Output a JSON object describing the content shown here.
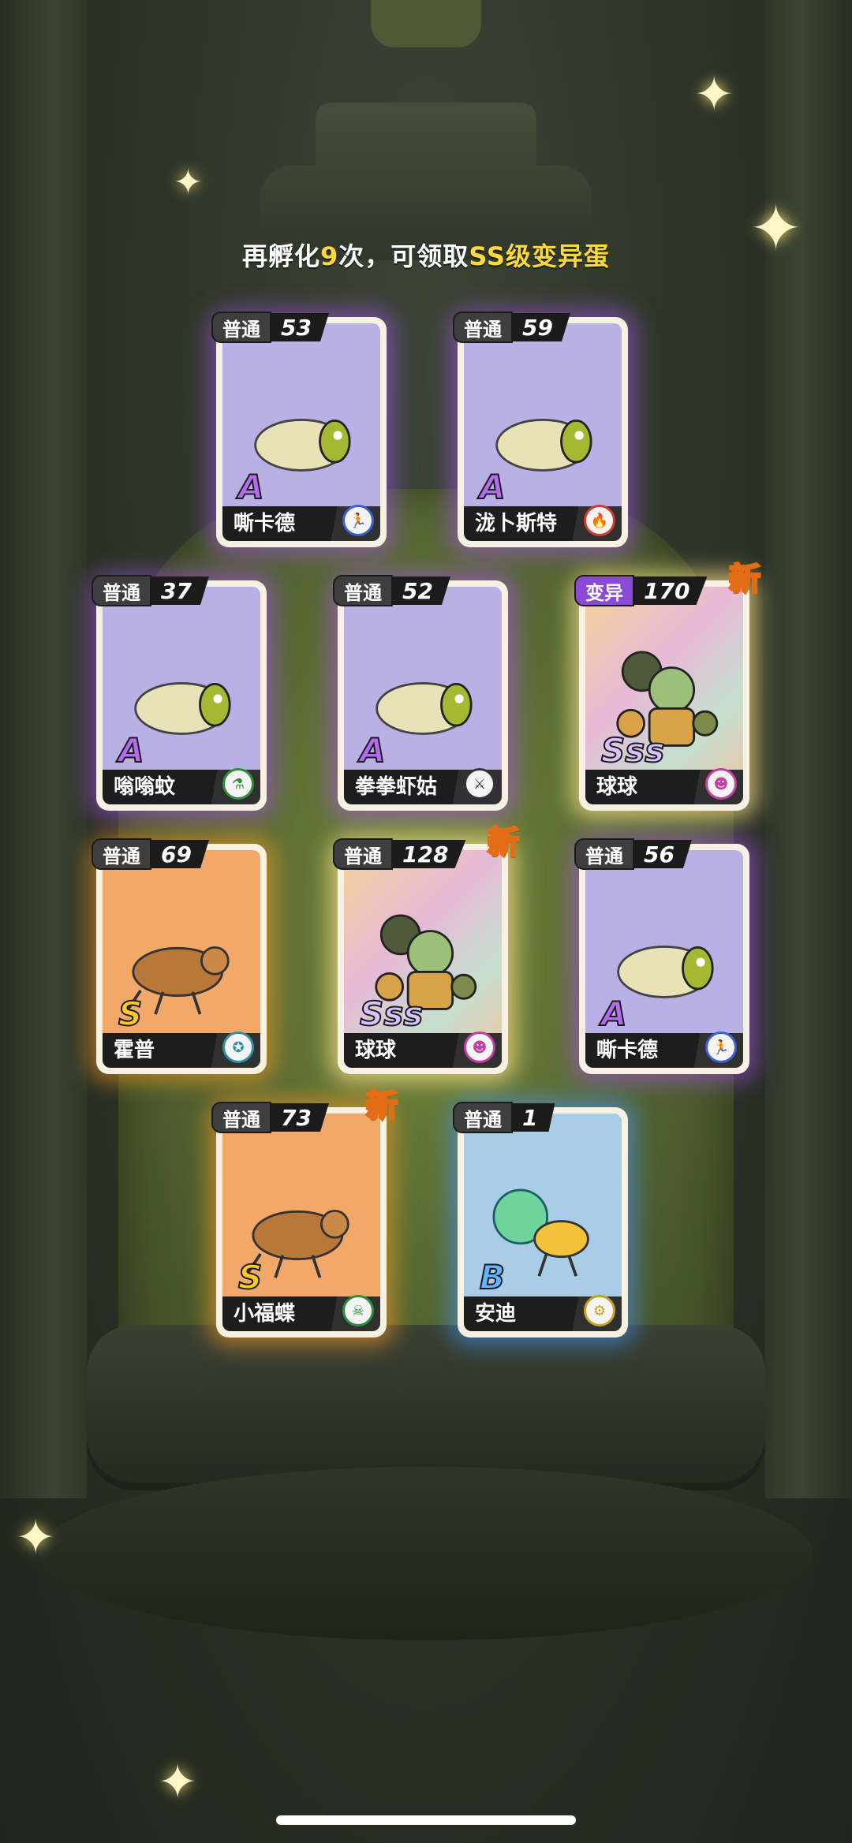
{
  "hatch_prompt": {
    "prefix": "再孵化",
    "count": "9",
    "middle": "次，可领取",
    "reward": "SS级变异蛋"
  },
  "cards": [
    {
      "type_label": "普通",
      "level": "53",
      "grade": "A",
      "name": "嘶卡德",
      "bg": "purple",
      "role_icon": "runner-icon",
      "is_new": false
    },
    {
      "type_label": "普通",
      "level": "59",
      "grade": "A",
      "name": "泷卜斯特",
      "bg": "purple",
      "role_icon": "fire-icon",
      "is_new": false
    },
    {
      "type_label": "普通",
      "level": "37",
      "grade": "A",
      "name": "嗡嗡蚊",
      "bg": "purple",
      "role_icon": "bottle-icon",
      "is_new": false
    },
    {
      "type_label": "普通",
      "level": "52",
      "grade": "A",
      "name": "拳拳虾姑",
      "bg": "purple",
      "role_icon": "sword-icon",
      "is_new": false
    },
    {
      "type_label": "变异",
      "level": "170",
      "grade": "Sss",
      "name": "球球",
      "bg": "rainbow",
      "role_icon": "mask-icon",
      "is_new": true
    },
    {
      "type_label": "普通",
      "level": "69",
      "grade": "S",
      "name": "霍普",
      "bg": "orange",
      "role_icon": "star-icon",
      "is_new": false
    },
    {
      "type_label": "普通",
      "level": "128",
      "grade": "Sss",
      "name": "球球",
      "bg": "rainbow",
      "role_icon": "mask-icon",
      "is_new": true
    },
    {
      "type_label": "普通",
      "level": "56",
      "grade": "A",
      "name": "嘶卡德",
      "bg": "purple",
      "role_icon": "runner-icon",
      "is_new": false
    },
    {
      "type_label": "普通",
      "level": "73",
      "grade": "S",
      "name": "小福蝶",
      "bg": "orange",
      "role_icon": "skull-icon",
      "is_new": true
    },
    {
      "type_label": "普通",
      "level": "1",
      "grade": "B",
      "name": "安迪",
      "bg": "blue",
      "role_icon": "gear-icon",
      "is_new": false
    }
  ],
  "new_label": "新",
  "colors": {
    "purple_bg": "#b9b1e6",
    "orange_bg": "#f2a868",
    "blue_bg": "#a9cde6",
    "rainbow_bg": "#e9c8d8",
    "normal_tag": "#3e3e3e",
    "mutant_tag": "#8a4ad6",
    "highlight": "#ffd83a"
  }
}
